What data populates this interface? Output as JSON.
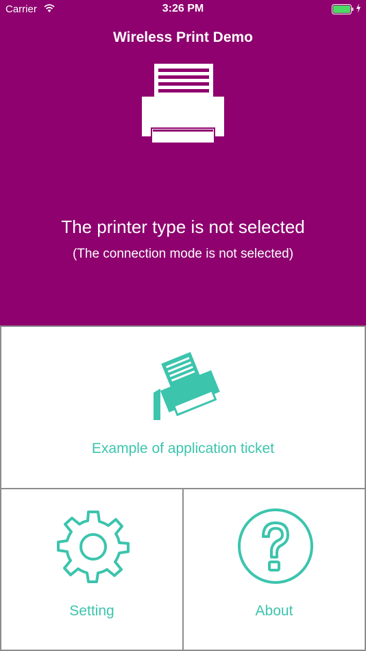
{
  "status_bar": {
    "carrier": "Carrier",
    "time": "3:26 PM"
  },
  "header": {
    "title": "Wireless Print Demo",
    "status_title": "The printer type is not selected",
    "status_subtitle": "(The connection mode is not selected)",
    "icon": "printer-icon"
  },
  "menu": {
    "ticket": {
      "label": "Example of application ticket",
      "icon": "printer-ticket-icon"
    },
    "setting": {
      "label": "Setting",
      "icon": "gear-icon"
    },
    "about": {
      "label": "About",
      "icon": "question-icon"
    }
  },
  "colors": {
    "header_background": "#8e016e",
    "accent": "#3cc4ad",
    "battery": "#4cd964",
    "tile_border": "#8c8c8c"
  }
}
